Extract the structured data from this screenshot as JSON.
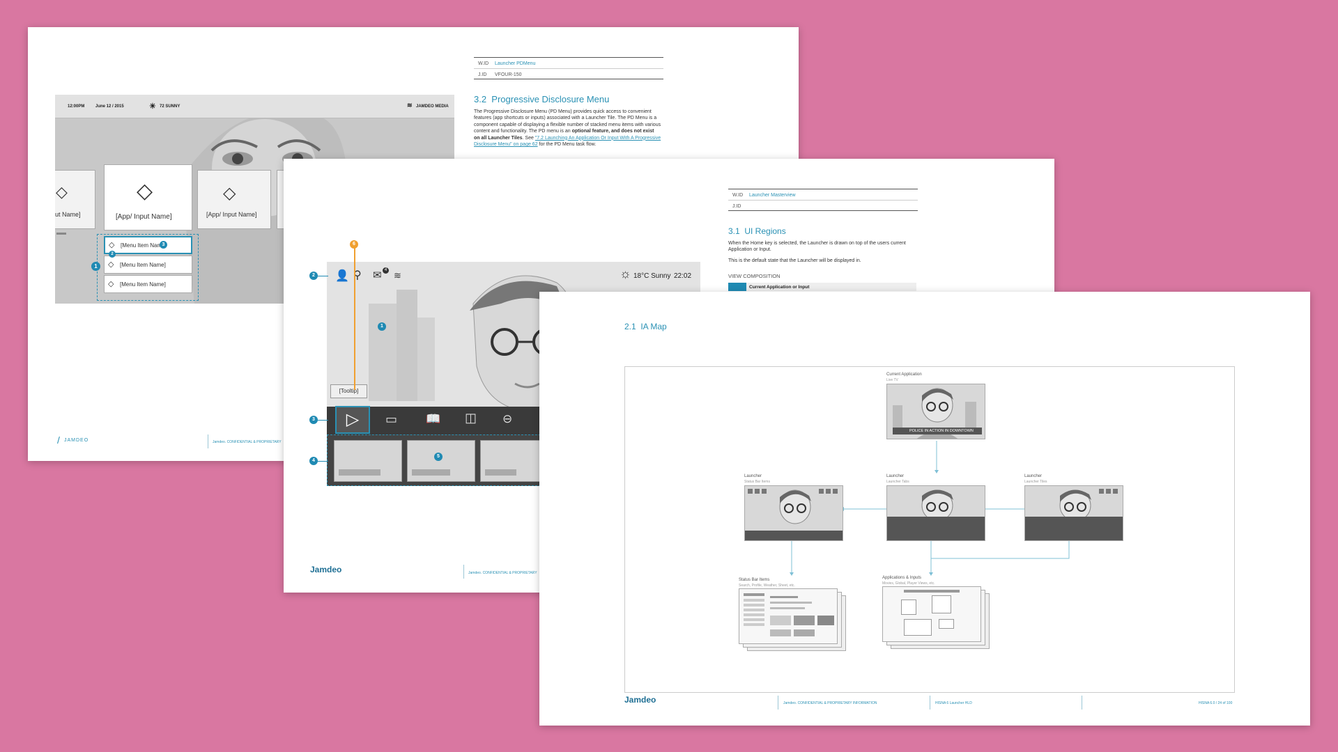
{
  "page1": {
    "meta": {
      "wid_label": "W.ID",
      "wid_value": "Launcher PDMenu",
      "jid_label": "J.ID",
      "jid_value": "VFOUR-150"
    },
    "heading": "3.2  Progressive Disclosure Menu",
    "body": [
      "The Progressive Disclosure Menu (PD Menu) provides quick access to convenient",
      "features (app shortcuts or inputs) associated with a Launcher Tile. The PD Menu is a",
      "component capable of displaying a flexible number of stacked menu items with various",
      "content and functionality. The PD menu is an ",
      "optional feature, and does not exist",
      "on all Launcher Tiles",
      ". See ",
      "\"7.2 Launching An Application Or Input With A Progressive",
      "Disclosure Menu\" on page 62",
      " for the PD Menu task flow."
    ],
    "status": {
      "time": "12:00PM",
      "date": "June 12 / 2015",
      "weather": "72 SUNNY",
      "brand": "JAMDEO MEDIA"
    },
    "tiles": {
      "left": "put Name]",
      "center": "[App/ Input Name]",
      "right": "[App/ Input Name]"
    },
    "menu_items": [
      "[Menu Item Nam",
      "[Menu Item Name]",
      "[Menu Item Name]"
    ],
    "badges": [
      "1",
      "2",
      "3"
    ],
    "logo": "JAMDEO",
    "footer_text": "Jamdeo. CONFIDENTIAL & PROPRIETARY"
  },
  "page2": {
    "meta": {
      "wid_label": "W.ID",
      "wid_value": "Launcher Masterview",
      "jid_label": "J.ID",
      "jid_value": ""
    },
    "heading": "3.1  UI Regions",
    "body1": "When the Home key is selected, the Launcher is drawn on top of the users current Application or Input.",
    "body2": "This is the default state that the Launcher will be displayed in.",
    "view_comp": "VIEW COMPOSITION",
    "legend_item": "Current Application or Input",
    "status": {
      "weather": "18°C Sunny",
      "time": "22:02",
      "mail_count": "4"
    },
    "tooltip": "[Tooltip]",
    "badges": [
      "2",
      "1",
      "3",
      "4",
      "5",
      "6"
    ],
    "logo": "Jamdeo",
    "footer_text": "Jamdeo. CONFIDENTIAL & PROPRIETARY"
  },
  "page3": {
    "heading": "2.1  IA Map",
    "nodes": {
      "current": {
        "title": "Current Application",
        "sub": "Live TV",
        "banner": "POLICE IN ACTION IN DOWNTOWN"
      },
      "l1": {
        "title": "Launcher",
        "sub": "Status Bar Items"
      },
      "l2": {
        "title": "Launcher",
        "sub": "Launcher Tabs"
      },
      "l3": {
        "title": "Launcher",
        "sub": "Launcher Tiles"
      },
      "sb": {
        "title": "Status Bar Items",
        "sub": "Search, Profile, Weather, Sheet, etc."
      },
      "apps": {
        "title": "Applications & Inputs",
        "sub": "Movies, Global, Player Views, etc."
      }
    },
    "logo": "Jamdeo",
    "footer": [
      "Jamdeo. CONFIDENTIAL & PROPRIETARY INFORMATION",
      "HISNA 6 Launcher HLD",
      "HISNA 6.0 / 24 of 100"
    ]
  },
  "colors": {
    "background": "#d977a1",
    "accent": "#2a91b4",
    "orange": "#f0a030"
  }
}
